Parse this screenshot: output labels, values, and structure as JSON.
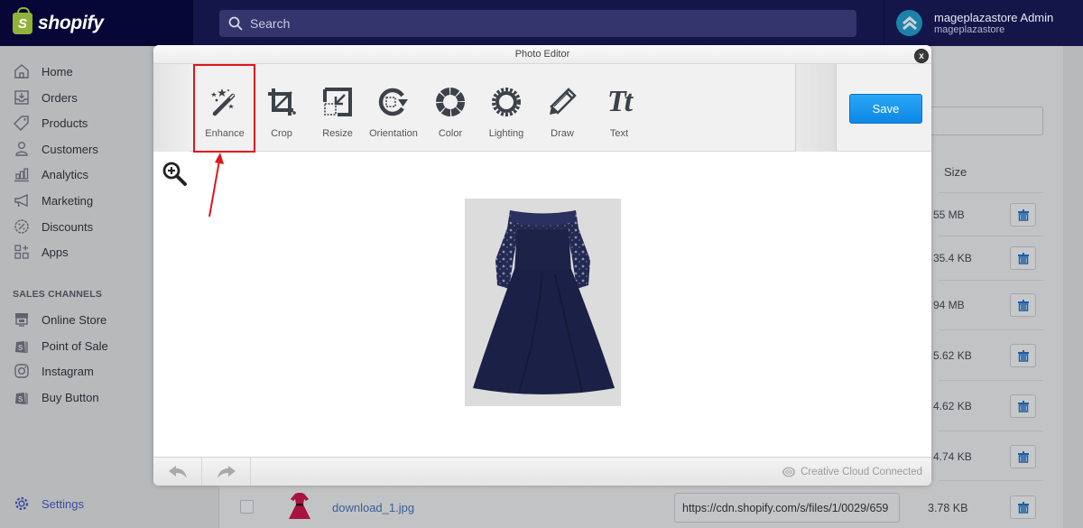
{
  "topbar": {
    "brand": "shopify",
    "brand_letter": "S",
    "search_placeholder": "Search",
    "account_name": "mageplazastore Admin",
    "account_store": "mageplazastore"
  },
  "sidebar": {
    "items": [
      {
        "label": "Home",
        "icon": "home-icon"
      },
      {
        "label": "Orders",
        "icon": "orders-icon"
      },
      {
        "label": "Products",
        "icon": "tag-icon"
      },
      {
        "label": "Customers",
        "icon": "person-icon"
      },
      {
        "label": "Analytics",
        "icon": "bar-chart-icon"
      },
      {
        "label": "Marketing",
        "icon": "megaphone-icon"
      },
      {
        "label": "Discounts",
        "icon": "discount-icon"
      },
      {
        "label": "Apps",
        "icon": "apps-icon"
      }
    ],
    "section_title": "SALES CHANNELS",
    "channels": [
      {
        "label": "Online Store",
        "icon": "store-icon"
      },
      {
        "label": "Point of Sale",
        "icon": "shopify-bag-icon"
      },
      {
        "label": "Instagram",
        "icon": "instagram-icon"
      },
      {
        "label": "Buy Button",
        "icon": "shopify-bag-icon"
      }
    ],
    "settings_label": "Settings"
  },
  "files": {
    "size_header": "Size",
    "sizes": [
      "55 MB",
      "35.4 KB",
      "94 MB",
      "5.62 KB",
      "4.62 KB",
      "4.74 KB"
    ],
    "last_row": {
      "filename": "download_1.jpg",
      "url": "https://cdn.shopify.com/s/files/1/0029/659",
      "size": "3.78 KB"
    }
  },
  "editor": {
    "title": "Photo Editor",
    "close_label": "x",
    "tools": [
      {
        "label": "Enhance",
        "icon": "magic-wand-icon"
      },
      {
        "label": "Crop",
        "icon": "crop-icon"
      },
      {
        "label": "Resize",
        "icon": "resize-icon"
      },
      {
        "label": "Orientation",
        "icon": "rotate-icon"
      },
      {
        "label": "Color",
        "icon": "color-wheel-icon"
      },
      {
        "label": "Lighting",
        "icon": "sun-icon"
      },
      {
        "label": "Draw",
        "icon": "pencil-icon"
      },
      {
        "label": "Text",
        "icon": "text-icon"
      }
    ],
    "text_glyph": "Tt",
    "save_label": "Save",
    "footer_status": "Creative Cloud Connected",
    "accent": "#1a9bf0",
    "highlight_color": "#e0141b"
  }
}
